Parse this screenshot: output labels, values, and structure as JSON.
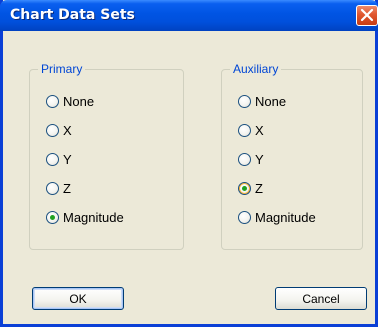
{
  "window": {
    "title": "Chart Data Sets",
    "close_icon": "close-icon"
  },
  "primary": {
    "legend": "Primary",
    "options": [
      {
        "label": "None",
        "checked": false
      },
      {
        "label": "X",
        "checked": false
      },
      {
        "label": "Y",
        "checked": false
      },
      {
        "label": "Z",
        "checked": false
      },
      {
        "label": "Magnitude",
        "checked": true
      }
    ]
  },
  "auxiliary": {
    "legend": "Auxiliary",
    "options": [
      {
        "label": "None",
        "checked": false
      },
      {
        "label": "X",
        "checked": false
      },
      {
        "label": "Y",
        "checked": false
      },
      {
        "label": "Z",
        "checked": true
      },
      {
        "label": "Magnitude",
        "checked": false
      }
    ]
  },
  "buttons": {
    "ok_label": "OK",
    "cancel_label": "Cancel"
  },
  "colors": {
    "title_bar": "#0054e3",
    "dialog_face": "#ece9d8",
    "group_legend": "#0046d5",
    "radio_selected": "#21a121"
  }
}
